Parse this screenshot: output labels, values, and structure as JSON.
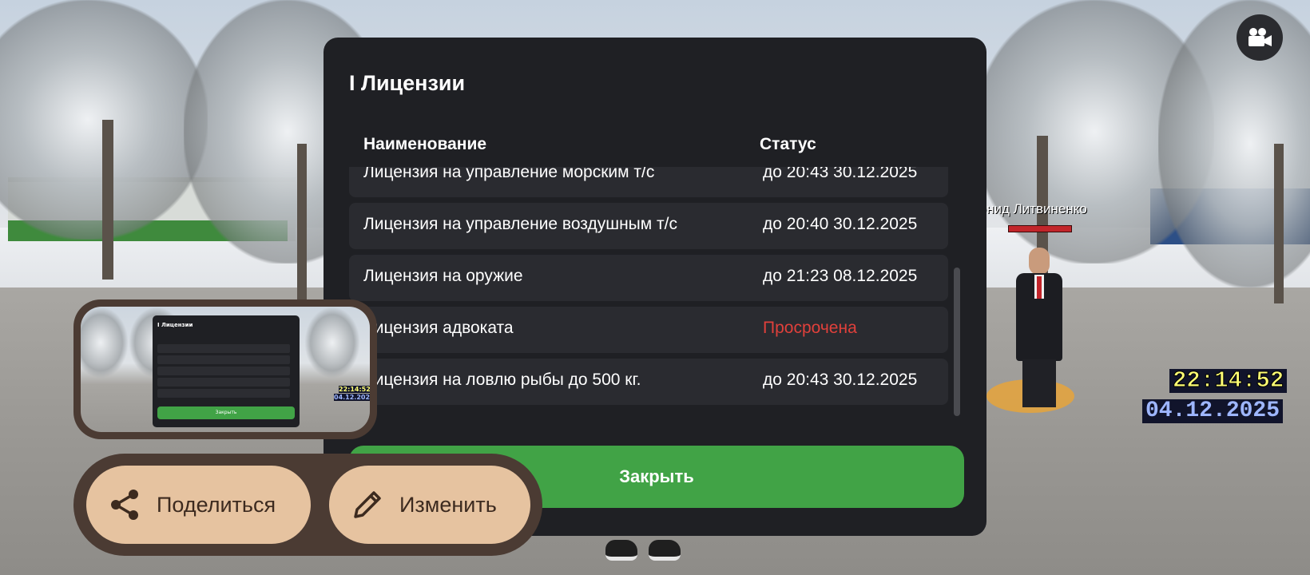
{
  "window": {
    "title": "Лицензии"
  },
  "licenses": {
    "title": "I Лицензии",
    "columns": {
      "name": "Наименование",
      "status": "Статус"
    },
    "rows": [
      {
        "name": "Лицензия на управление морским т/с",
        "status": "до 20:43 30.12.2025",
        "expired": false
      },
      {
        "name": "Лицензия на управление воздушным т/с",
        "status": "до 20:40 30.12.2025",
        "expired": false
      },
      {
        "name": "Лицензия на оружие",
        "status": "до 21:23 08.12.2025",
        "expired": false
      },
      {
        "name": "Лицензия адвоката",
        "status": "Просрочена",
        "expired": true
      },
      {
        "name": "Лицензия на ловлю рыбы до 500 кг.",
        "status": "до 20:43 30.12.2025",
        "expired": false
      }
    ],
    "close_label": "Закрыть",
    "expired_color": "#e0403b",
    "accent_color": "#41a346"
  },
  "hud": {
    "player_name": "Леонид Литвиненко",
    "time": "22:14:52",
    "date": "04.12.2025",
    "camera_icon": "video-camera-icon"
  },
  "screenshot_overlay": {
    "share_label": "Поделиться",
    "edit_label": "Изменить",
    "share_icon": "share-icon",
    "edit_icon": "pencil-icon",
    "thumbnail_title": "I Лицензии",
    "thumbnail_close": "Закрыть",
    "thumbnail_time": "22:14:52",
    "thumbnail_date": "04.12.2025"
  }
}
